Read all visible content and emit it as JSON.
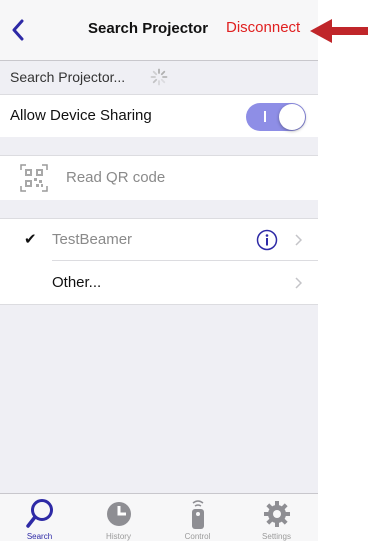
{
  "navbar": {
    "title": "Search Projector",
    "action_label": "Disconnect",
    "back_icon": "chevron-left-icon"
  },
  "search_section": {
    "label": "Search Projector...",
    "spinner_icon": "activity-spinner-icon"
  },
  "sharing": {
    "label": "Allow Device Sharing",
    "enabled": true
  },
  "qr": {
    "label": "Read QR code",
    "icon": "qr-code-icon"
  },
  "projectors": [
    {
      "name": "TestBeamer",
      "selected": true,
      "has_info": true
    },
    {
      "name": "Other...",
      "selected": false,
      "has_info": false
    }
  ],
  "tabs": [
    {
      "label": "Search",
      "icon": "search-icon",
      "active": true
    },
    {
      "label": "History",
      "icon": "clock-icon",
      "active": false
    },
    {
      "label": "Control",
      "icon": "remote-control-icon",
      "active": false
    },
    {
      "label": "Settings",
      "icon": "gear-icon",
      "active": false
    }
  ],
  "colors": {
    "accent": "#2e2aa6",
    "destructive": "#e02020",
    "toggle_on": "#8e8ee6",
    "annotation_arrow": "#c0262a"
  }
}
